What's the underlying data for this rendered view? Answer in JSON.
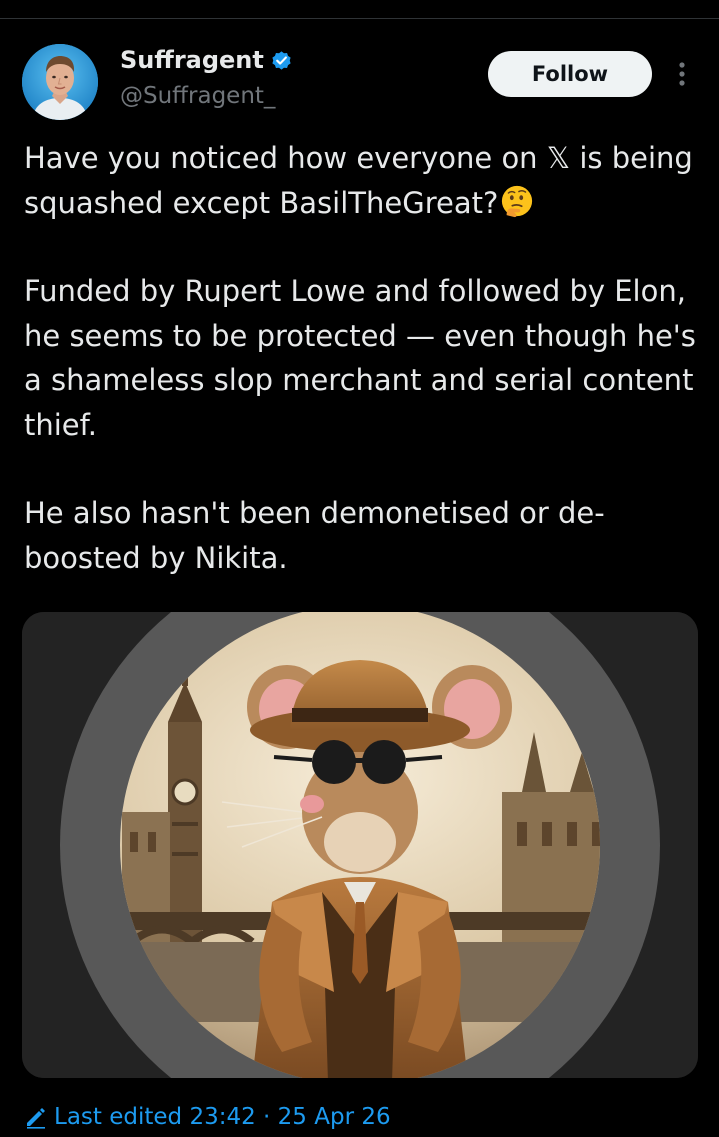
{
  "post": {
    "author": {
      "name": "Suffragent",
      "handle": "@Suffragent_",
      "verified": true,
      "avatar_icon": "man-portrait-avatar"
    },
    "follow_label": "Follow",
    "more_icon": "more-vertical-icon",
    "text": {
      "paragraph1": "Have you noticed how everyone on 𝕏 is being squashed except BasilTheGreat?",
      "paragraph1_emoji": "thinking-face-emoji",
      "paragraph2": "Funded by Rupert Lowe and followed by Elon, he seems to be protected — even though he's a shameless slop merchant and serial content thief.",
      "paragraph3": "He also hasn't been demonetised or de-boosted by Nikita."
    },
    "media": {
      "type": "image",
      "subject": "mouse-detective-illustration"
    },
    "edited": {
      "label": "Last edited 23:42 · 25 Apr 26",
      "icon": "edit-pencil-icon"
    }
  },
  "colors": {
    "background": "#000000",
    "text": "#e7e9ea",
    "secondary": "#71767b",
    "accent": "#1d9bf0",
    "follow_bg": "#eff3f4"
  }
}
